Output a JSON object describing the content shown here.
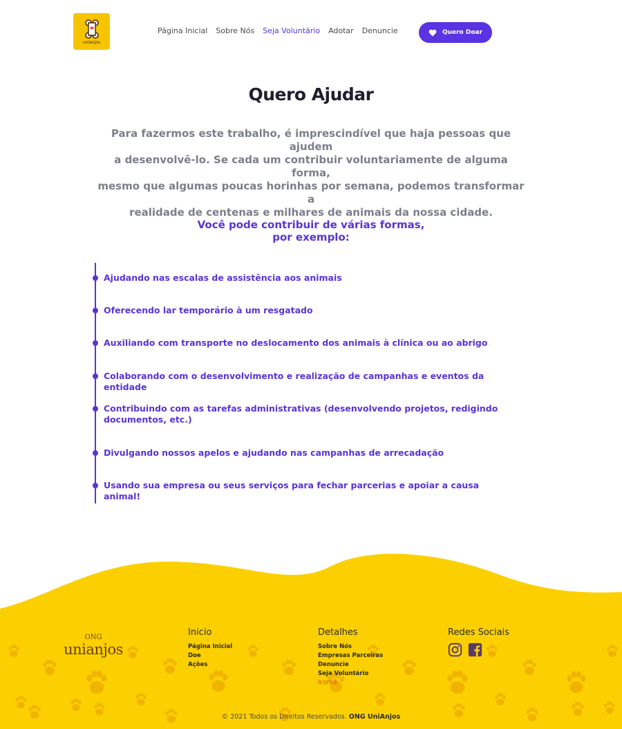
{
  "header": {
    "logo_text": "unianjos",
    "nav": [
      {
        "label": "Página Inicial",
        "active": false
      },
      {
        "label": "Sobre Nós",
        "active": false
      },
      {
        "label": "Seja Voluntário",
        "active": true
      },
      {
        "label": "Adotar",
        "active": false
      },
      {
        "label": "Denuncie",
        "active": false
      }
    ],
    "donate_label": "Quero Doar"
  },
  "main": {
    "title": "Quero Ajudar",
    "intro_lines": [
      "Para fazermos este trabalho, é imprescindível que haja pessoas que ajudem",
      "a desenvolvê-lo. Se cada um contribuir voluntariamente de alguma forma,",
      "mesmo que algumas poucas horinhas por semana, podemos transformar a",
      "realidade de centenas e milhares de animais da nossa cidade."
    ],
    "subtitle_lines": [
      "Você pode contribuir de várias formas,",
      "por exemplo:"
    ],
    "items": [
      "Ajudando nas escalas de assistência aos animais",
      "Oferecendo lar temporário à um resgatado",
      "Auxiliando com transporte no deslocamento dos animais à clínica ou ao abrigo",
      "Colaborando com o desenvolvimento e realização de campanhas e eventos da entidade",
      "Contribuindo com as tarefas administrativas (desenvolvendo projetos, redigindo documentos, etc.)",
      "Divulgando nossos apelos e ajudando nas campanhas de arrecadação",
      "Usando sua empresa ou seus serviços para fechar parcerias e apoiar a causa animal!"
    ]
  },
  "footer": {
    "logo_small": "ONG",
    "logo_brand": "unianjos",
    "columns": [
      {
        "title": "Inicio",
        "links": [
          "Página Inicial",
          "Doe",
          "Ações"
        ]
      },
      {
        "title": "Detalhes",
        "links": [
          "Sobre Nós",
          "Empresas Parceiras",
          "Denuncie",
          "Seja Voluntário"
        ],
        "credit": "Icons8"
      },
      {
        "title": "Redes Sociais",
        "icons": [
          "instagram-icon",
          "facebook-icon"
        ]
      }
    ],
    "copyright_prefix": "© 2021 Todos os Direitos Reservados.",
    "copyright_brand": "ONG UniAnjos"
  },
  "colors": {
    "accent": "#5a33d6",
    "footer_yellow": "#fcd000",
    "logo_yellow": "#f7c500",
    "paw": "#f0b400"
  }
}
